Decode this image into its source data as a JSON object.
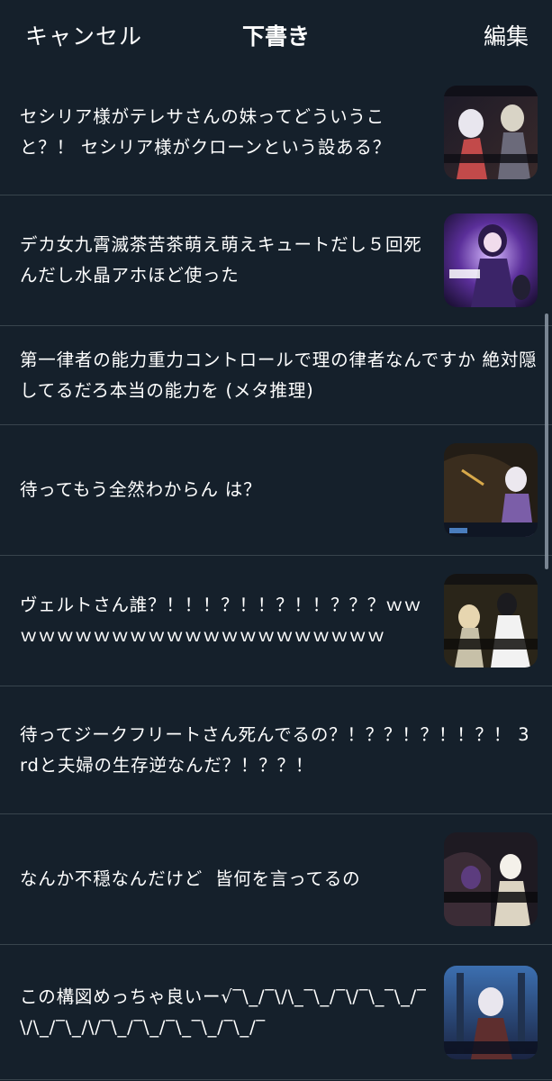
{
  "header": {
    "cancel_label": "キャンセル",
    "title": "下書き",
    "edit_label": "編集"
  },
  "drafts": [
    {
      "text": "セシリア様がテレサさんの妹ってどういうこと？！ セシリア様がクローンという設ある？",
      "has_thumbnail": true,
      "thumbnail_icon": "game-screenshot-thumbnail"
    },
    {
      "text": "デカ女九霄滅茶苦茶萌え萌えキュートだし５回死んだし水晶アホほど使った",
      "has_thumbnail": true,
      "thumbnail_icon": "character-art-thumbnail"
    },
    {
      "text": "第一律者の能力重力コントロールで理の律者なんですか 絶対隠してるだろ本当の能力を (メタ推理)",
      "has_thumbnail": false
    },
    {
      "text": "待ってもう全然わからん は？",
      "has_thumbnail": true,
      "thumbnail_icon": "game-screenshot-thumbnail"
    },
    {
      "text": "ヴェルトさん誰？！！！？！！？！！？？？ｗｗｗｗｗｗｗｗｗｗｗｗｗｗｗｗｗｗｗｗｗｗ",
      "has_thumbnail": true,
      "thumbnail_icon": "game-screenshot-thumbnail"
    },
    {
      "text": "待ってジークフリートさん死んでるの？！？？！？！！？！ 3rdと夫婦の生存逆なんだ？！？？！",
      "has_thumbnail": false
    },
    {
      "text": "なんか不穏なんだけど  皆何を言ってるの",
      "has_thumbnail": true,
      "thumbnail_icon": "game-screenshot-thumbnail"
    },
    {
      "text": "この構図めっちゃ良いー√‾\\_/‾\\/\\_‾\\_/‾\\/‾\\_‾\\_/‾\\/\\_/‾\\_/\\/‾\\_/‾\\_/‾\\_‾\\_/‾\\_/‾",
      "has_thumbnail": true,
      "thumbnail_icon": "game-screenshot-thumbnail"
    }
  ],
  "colors": {
    "background": "#15202b",
    "divider": "#38444d",
    "text": "#ffffff",
    "scrollbar": "#8b98a5"
  }
}
